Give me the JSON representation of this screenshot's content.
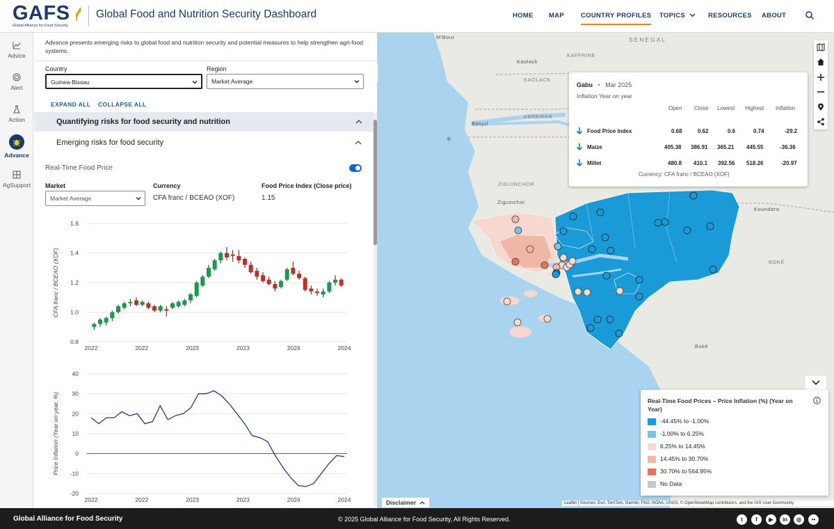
{
  "header": {
    "logo_text": "GAFS",
    "logo_sub": "Global Alliance for Food Security",
    "title": "Global Food and Nutrition Security Dashboard",
    "nav": [
      "HOME",
      "MAP",
      "COUNTRY PROFILES",
      "TOPICS",
      "RESOURCES",
      "ABOUT"
    ],
    "active_nav": "COUNTRY PROFILES"
  },
  "rail": [
    "Advice",
    "Alert",
    "Action",
    "Advance",
    "AgSupport"
  ],
  "rail_active": "Advance",
  "panel": {
    "intro": "Advance presents emerging risks to global food and nutrition security and potential measures to help strengthen agri-food systems.",
    "country_label": "Country",
    "country_value": "Guinea-Bissau",
    "region_label": "Region",
    "region_value": "Market Average",
    "expand_all": "EXPAND ALL",
    "collapse_all": "COLLAPSE ALL",
    "section_title": "Quantifying risks for food security and nutrition",
    "subsection_title": "Emerging risks for food security",
    "rt_title": "Real-Time Food Price",
    "market_label": "Market",
    "market_value": "Market Average",
    "currency_label": "Currency",
    "currency_value": "CFA franc / BCEAO (XOF)",
    "fpi_label": "Food Price Index (Close price)",
    "fpi_value": "1.15"
  },
  "chart_data": [
    {
      "type": "candlestick",
      "ylabel": "CFA franc / BCEAO (XOF)",
      "ylim": [
        0.8,
        1.6
      ],
      "yticks": [
        "1.6",
        "1.4",
        "1.2",
        "1.0",
        "0.8"
      ],
      "xticks": [
        "2022",
        "2022",
        "2023",
        "2023",
        "2024",
        "2024"
      ],
      "up_color": "#1a9a4a",
      "down_color": "#c0302b",
      "candles": [
        {
          "o": 0.9,
          "c": 0.92,
          "h": 0.93,
          "l": 0.88
        },
        {
          "o": 0.92,
          "c": 0.95,
          "h": 0.96,
          "l": 0.9
        },
        {
          "o": 0.93,
          "c": 0.96,
          "h": 0.97,
          "l": 0.91
        },
        {
          "o": 0.96,
          "c": 1.0,
          "h": 1.01,
          "l": 0.94
        },
        {
          "o": 1.0,
          "c": 1.04,
          "h": 1.05,
          "l": 0.99
        },
        {
          "o": 1.03,
          "c": 1.06,
          "h": 1.07,
          "l": 1.02
        },
        {
          "o": 1.06,
          "c": 1.07,
          "h": 1.09,
          "l": 1.04
        },
        {
          "o": 1.08,
          "c": 1.05,
          "h": 1.1,
          "l": 1.04
        },
        {
          "o": 1.05,
          "c": 1.07,
          "h": 1.08,
          "l": 1.04
        },
        {
          "o": 1.06,
          "c": 1.03,
          "h": 1.07,
          "l": 1.02
        },
        {
          "o": 1.04,
          "c": 1.01,
          "h": 1.05,
          "l": 1.0
        },
        {
          "o": 1.01,
          "c": 1.04,
          "h": 1.05,
          "l": 1.0
        },
        {
          "o": 1.02,
          "c": 1.01,
          "h": 1.04,
          "l": 0.97
        },
        {
          "o": 1.03,
          "c": 1.06,
          "h": 1.07,
          "l": 1.02
        },
        {
          "o": 1.04,
          "c": 1.07,
          "h": 1.08,
          "l": 1.03
        },
        {
          "o": 1.05,
          "c": 1.08,
          "h": 1.09,
          "l": 1.04
        },
        {
          "o": 1.08,
          "c": 1.12,
          "h": 1.13,
          "l": 1.06
        },
        {
          "o": 1.11,
          "c": 1.2,
          "h": 1.21,
          "l": 1.1
        },
        {
          "o": 1.18,
          "c": 1.24,
          "h": 1.25,
          "l": 1.17
        },
        {
          "o": 1.24,
          "c": 1.3,
          "h": 1.32,
          "l": 1.23
        },
        {
          "o": 1.29,
          "c": 1.35,
          "h": 1.36,
          "l": 1.28
        },
        {
          "o": 1.35,
          "c": 1.4,
          "h": 1.41,
          "l": 1.33
        },
        {
          "o": 1.4,
          "c": 1.37,
          "h": 1.44,
          "l": 1.35
        },
        {
          "o": 1.39,
          "c": 1.38,
          "h": 1.42,
          "l": 1.34
        },
        {
          "o": 1.38,
          "c": 1.35,
          "h": 1.42,
          "l": 1.33
        },
        {
          "o": 1.36,
          "c": 1.32,
          "h": 1.37,
          "l": 1.3
        },
        {
          "o": 1.32,
          "c": 1.27,
          "h": 1.34,
          "l": 1.26
        },
        {
          "o": 1.28,
          "c": 1.24,
          "h": 1.3,
          "l": 1.22
        },
        {
          "o": 1.25,
          "c": 1.21,
          "h": 1.27,
          "l": 1.2
        },
        {
          "o": 1.22,
          "c": 1.19,
          "h": 1.24,
          "l": 1.18
        },
        {
          "o": 1.19,
          "c": 1.16,
          "h": 1.21,
          "l": 1.14
        },
        {
          "o": 1.17,
          "c": 1.21,
          "h": 1.22,
          "l": 1.16
        },
        {
          "o": 1.22,
          "c": 1.29,
          "h": 1.3,
          "l": 1.21
        },
        {
          "o": 1.3,
          "c": 1.26,
          "h": 1.34,
          "l": 1.25
        },
        {
          "o": 1.26,
          "c": 1.23,
          "h": 1.28,
          "l": 1.22
        },
        {
          "o": 1.23,
          "c": 1.15,
          "h": 1.24,
          "l": 1.14
        },
        {
          "o": 1.16,
          "c": 1.14,
          "h": 1.18,
          "l": 1.12
        },
        {
          "o": 1.14,
          "c": 1.13,
          "h": 1.16,
          "l": 1.11
        },
        {
          "o": 1.12,
          "c": 1.14,
          "h": 1.16,
          "l": 1.1
        },
        {
          "o": 1.14,
          "c": 1.2,
          "h": 1.21,
          "l": 1.13
        },
        {
          "o": 1.2,
          "c": 1.22,
          "h": 1.25,
          "l": 1.18
        },
        {
          "o": 1.22,
          "c": 1.18,
          "h": 1.23,
          "l": 1.17
        }
      ]
    },
    {
      "type": "line",
      "ylabel": "Price Inflation (Year on year, %)",
      "ylim": [
        -20,
        40
      ],
      "yticks": [
        "40",
        "30",
        "20",
        "10",
        "0",
        "-10",
        "-20"
      ],
      "xticks": [
        "2022",
        "2022",
        "2023",
        "2023",
        "2024",
        "2024"
      ],
      "color": "#1b3a8b",
      "values": [
        18,
        15,
        18,
        18,
        21,
        19,
        20,
        15,
        16,
        24,
        17,
        19,
        20,
        23,
        30,
        30,
        31.5,
        29,
        25,
        20,
        15,
        9,
        8,
        6,
        -1,
        -7,
        -12,
        -16,
        -16.5,
        -15,
        -10,
        -5,
        -1,
        -1.5
      ]
    }
  ],
  "popup": {
    "place": "Gabu",
    "date": "Mar 2025",
    "subtitle": "Inflation Year on year",
    "headers": [
      "Open",
      "Close",
      "Lowest",
      "Highest",
      "Inflation"
    ],
    "rows": [
      {
        "name": "Food Price Index",
        "open": "0.68",
        "close": "0.62",
        "low": "0.6",
        "high": "0.74",
        "inflation": "-29.2"
      },
      {
        "name": "Maize",
        "open": "405.38",
        "close": "386.91",
        "low": "365.21",
        "high": "445.55",
        "inflation": "-36.36"
      },
      {
        "name": "Millet",
        "open": "480.8",
        "close": "410.1",
        "low": "392.56",
        "high": "518.26",
        "inflation": "-20.97"
      }
    ],
    "currency_note": "Currency: CFA franc / BCEAO (XOF)"
  },
  "map_labels": {
    "mbour": "M'Bour",
    "senegal": "SENEGAL",
    "kaffrine": "KAFFRINE",
    "kaolack": "Kaolack",
    "kaolack_region": "KAOLACK",
    "banjul": "Banjul",
    "kerewan": "KEREWAN",
    "ziguinchor_region": "ZIGUINCHOR",
    "ziguinchor": "Ziguinchor",
    "koundara": "Koundara",
    "boke_region": "BOKÉ",
    "boke": "Boké",
    "b": "B"
  },
  "legend": {
    "title": "Real-Time Food Prices – Price Inflation (%) (Year on Year)",
    "items": [
      {
        "label": "-44.45% to -1.00%",
        "color": "#1a9ad6"
      },
      {
        "label": "-1.00% to 6.25%",
        "color": "#7cc3e3"
      },
      {
        "label": "6.25% to 14.45%",
        "color": "#f6d8d0"
      },
      {
        "label": "14.45% to 30.70%",
        "color": "#f0b6a6"
      },
      {
        "label": "30.70% to 564.95%",
        "color": "#e8735a"
      },
      {
        "label": "No Data",
        "color": "#c8c8c8"
      }
    ]
  },
  "disclaimer": "Disclaimer",
  "attribution": "Leaflet | Sources: Esri, TomTom, Garmin, FAO, NOAA, USGS, © OpenStreetMap contributors, and the GIS User Community",
  "footer": {
    "left": "Global Alliance for Food Security",
    "center": "© 2025 Global Alliance for Food Security, All Rights Reserved."
  }
}
